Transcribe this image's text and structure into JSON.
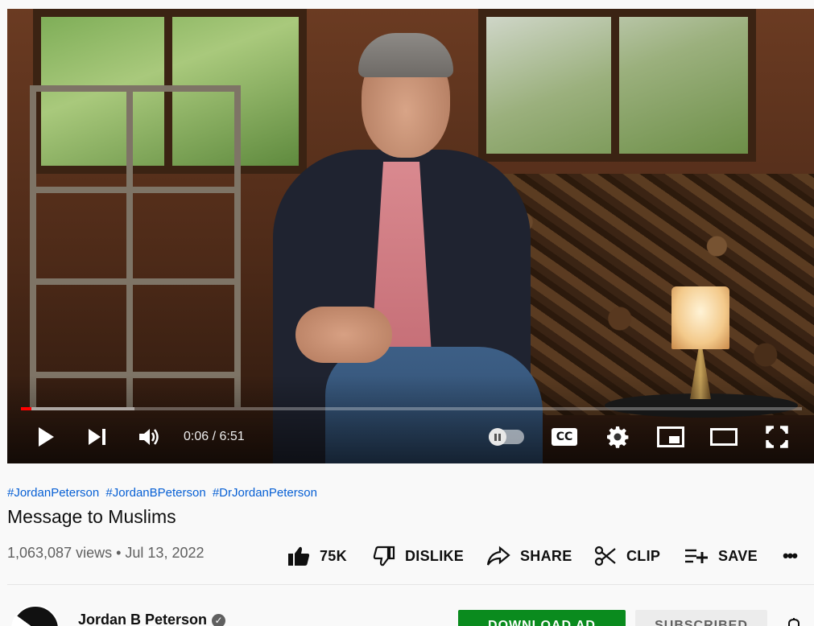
{
  "player": {
    "time_display": "0:06 / 6:51",
    "progress_played_fraction": 0.013,
    "progress_buffered_fraction": 0.145,
    "controls": {
      "play_icon": "play-icon",
      "next_icon": "skip-next-icon",
      "volume_icon": "volume-icon",
      "autoplay_icon": "autoplay-toggle-icon",
      "cc_label": "CC",
      "settings_icon": "gear-icon",
      "miniplayer_icon": "miniplayer-icon",
      "theater_icon": "theater-mode-icon",
      "fullscreen_icon": "fullscreen-icon"
    }
  },
  "video": {
    "hashtags": [
      "#JordanPeterson",
      "#JordanBPeterson",
      "#DrJordanPeterson"
    ],
    "title": "Message to Muslims",
    "views": "1,063,087 views",
    "separator": "•",
    "date": "Jul 13, 2022"
  },
  "actions": {
    "like": {
      "label": "75K",
      "icon": "thumbs-up-icon"
    },
    "dislike": {
      "label": "DISLIKE",
      "icon": "thumbs-down-icon"
    },
    "share": {
      "label": "SHARE",
      "icon": "share-icon"
    },
    "clip": {
      "label": "CLIP",
      "icon": "scissors-icon"
    },
    "save": {
      "label": "SAVE",
      "icon": "playlist-add-icon"
    },
    "more": {
      "label": "•••",
      "icon": "more-icon"
    }
  },
  "channel": {
    "name": "Jordan B Peterson",
    "verified_mark": "✓",
    "download_label": "DOWNLOAD AD",
    "subscribed_label": "SUBSCRIBED"
  },
  "colors": {
    "hashtag": "#065fd4",
    "progress_played": "#ff0000",
    "download_button": "#0a8b1e"
  }
}
